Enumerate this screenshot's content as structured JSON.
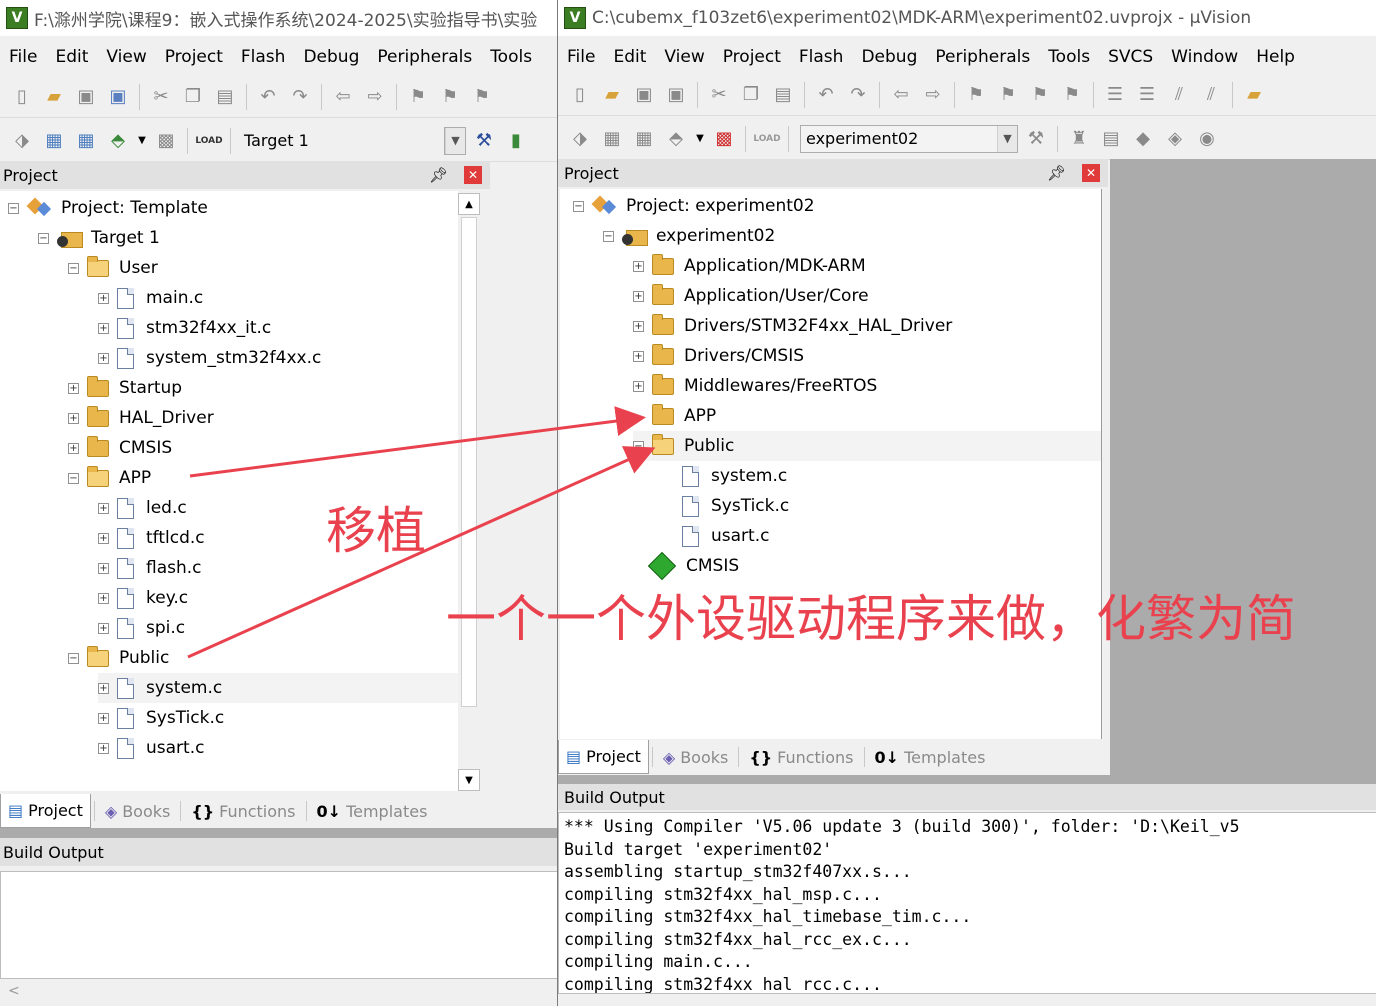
{
  "left_window": {
    "title": "F:\\滁州学院\\课程9：嵌入式操作系统\\2024-2025\\实验指导书\\实验",
    "menu": [
      "File",
      "Edit",
      "View",
      "Project",
      "Flash",
      "Debug",
      "Peripherals",
      "Tools"
    ],
    "target_combo": "Target 1",
    "panel_title": "Project",
    "tree": [
      {
        "label": "Project: Template",
        "depth": 0,
        "kind": "project",
        "exp": "minus"
      },
      {
        "label": "Target 1",
        "depth": 1,
        "kind": "target",
        "exp": "minus"
      },
      {
        "label": "User",
        "depth": 2,
        "kind": "folder-open",
        "exp": "minus"
      },
      {
        "label": "main.c",
        "depth": 3,
        "kind": "file",
        "exp": "plus"
      },
      {
        "label": "stm32f4xx_it.c",
        "depth": 3,
        "kind": "file",
        "exp": "plus"
      },
      {
        "label": "system_stm32f4xx.c",
        "depth": 3,
        "kind": "file",
        "exp": "plus"
      },
      {
        "label": "Startup",
        "depth": 2,
        "kind": "folder",
        "exp": "plus"
      },
      {
        "label": "HAL_Driver",
        "depth": 2,
        "kind": "folder",
        "exp": "plus"
      },
      {
        "label": "CMSIS",
        "depth": 2,
        "kind": "folder",
        "exp": "plus"
      },
      {
        "label": "APP",
        "depth": 2,
        "kind": "folder-open",
        "exp": "minus"
      },
      {
        "label": "led.c",
        "depth": 3,
        "kind": "file",
        "exp": "plus"
      },
      {
        "label": "tftlcd.c",
        "depth": 3,
        "kind": "file",
        "exp": "plus"
      },
      {
        "label": "flash.c",
        "depth": 3,
        "kind": "file",
        "exp": "plus"
      },
      {
        "label": "key.c",
        "depth": 3,
        "kind": "file",
        "exp": "plus"
      },
      {
        "label": "spi.c",
        "depth": 3,
        "kind": "file",
        "exp": "plus"
      },
      {
        "label": "Public",
        "depth": 2,
        "kind": "folder-open",
        "exp": "minus"
      },
      {
        "label": "system.c",
        "depth": 3,
        "kind": "file",
        "exp": "plus",
        "selected": true
      },
      {
        "label": "SysTick.c",
        "depth": 3,
        "kind": "file",
        "exp": "plus"
      },
      {
        "label": "usart.c",
        "depth": 3,
        "kind": "file",
        "exp": "plus"
      }
    ],
    "tabs": [
      "Project",
      "Books",
      "Functions",
      "Templates"
    ],
    "build_output_title": "Build Output"
  },
  "right_window": {
    "title": "C:\\cubemx_f103zet6\\experiment02\\MDK-ARM\\experiment02.uvprojx - µVision",
    "menu": [
      "File",
      "Edit",
      "View",
      "Project",
      "Flash",
      "Debug",
      "Peripherals",
      "Tools",
      "SVCS",
      "Window",
      "Help"
    ],
    "target_combo": "experiment02",
    "panel_title": "Project",
    "tree": [
      {
        "label": "Project: experiment02",
        "depth": 0,
        "kind": "project",
        "exp": "minus"
      },
      {
        "label": "experiment02",
        "depth": 1,
        "kind": "target",
        "exp": "minus"
      },
      {
        "label": "Application/MDK-ARM",
        "depth": 2,
        "kind": "folder",
        "exp": "plus"
      },
      {
        "label": "Application/User/Core",
        "depth": 2,
        "kind": "folder",
        "exp": "plus"
      },
      {
        "label": "Drivers/STM32F4xx_HAL_Driver",
        "depth": 2,
        "kind": "folder",
        "exp": "plus"
      },
      {
        "label": "Drivers/CMSIS",
        "depth": 2,
        "kind": "folder",
        "exp": "plus"
      },
      {
        "label": "Middlewares/FreeRTOS",
        "depth": 2,
        "kind": "folder",
        "exp": "plus"
      },
      {
        "label": "APP",
        "depth": 2,
        "kind": "folder",
        "exp": "none"
      },
      {
        "label": "Public",
        "depth": 2,
        "kind": "folder-open",
        "exp": "minus",
        "selected": true
      },
      {
        "label": "system.c",
        "depth": 3,
        "kind": "file",
        "exp": "none"
      },
      {
        "label": "SysTick.c",
        "depth": 3,
        "kind": "file",
        "exp": "none"
      },
      {
        "label": "usart.c",
        "depth": 3,
        "kind": "file",
        "exp": "none"
      },
      {
        "label": "CMSIS",
        "depth": 2,
        "kind": "cmsis",
        "exp": "none"
      }
    ],
    "tabs": [
      "Project",
      "Books",
      "Functions",
      "Templates"
    ],
    "build_output_title": "Build Output",
    "build_output": [
      "*** Using Compiler 'V5.06 update 3 (build 300)', folder: 'D:\\Keil_v5",
      "Build target 'experiment02'",
      "assembling startup_stm32f407xx.s...",
      "compiling stm32f4xx_hal_msp.c...",
      "compiling stm32f4xx_hal_timebase_tim.c...",
      "compiling stm32f4xx_hal_rcc_ex.c...",
      "compiling main.c...",
      "compiling stm32f4xx_hal_rcc.c..."
    ]
  },
  "annotations": {
    "port": "移植",
    "note": "一个一个外设驱动程序来做，化繁为简",
    "color": "#e9424e"
  }
}
